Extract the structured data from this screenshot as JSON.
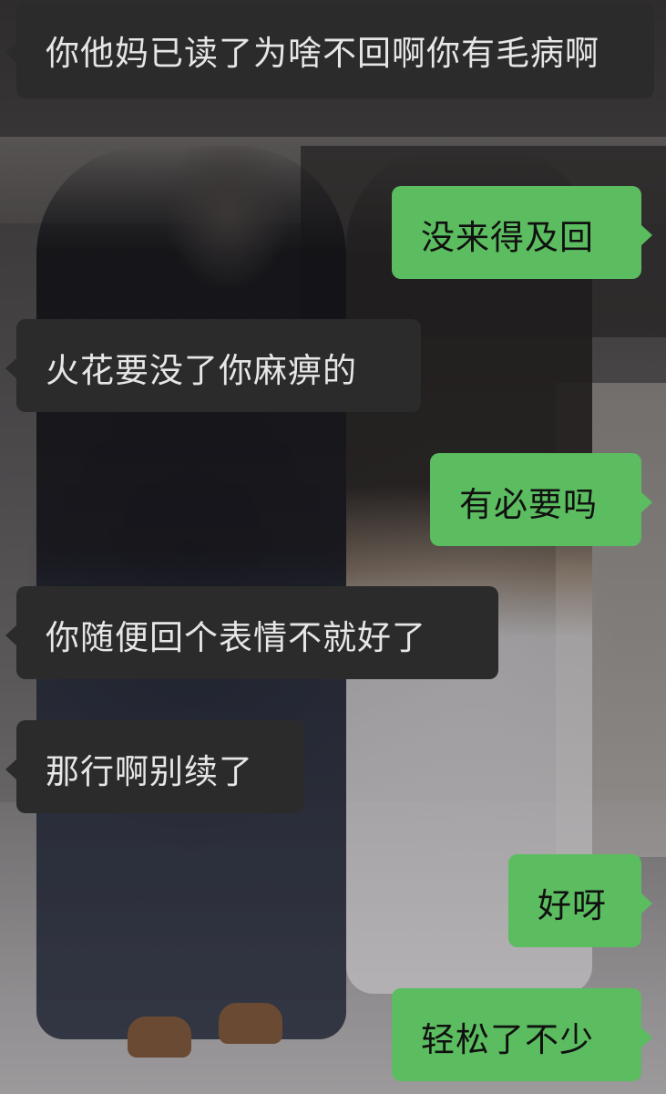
{
  "conversation": {
    "messages": [
      {
        "side": "received",
        "text": "你他妈已读了为啥不回啊你有毛病啊"
      },
      {
        "side": "sent",
        "text": "没来得及回"
      },
      {
        "side": "received",
        "text": "火花要没了你麻痹的"
      },
      {
        "side": "sent",
        "text": "有必要吗"
      },
      {
        "side": "received",
        "text": "你随便回个表情不就好了"
      },
      {
        "side": "received",
        "text": "那行啊别续了"
      },
      {
        "side": "sent",
        "text": "好呀"
      },
      {
        "side": "sent",
        "text": "轻松了不少"
      }
    ]
  },
  "colors": {
    "received_bubble": "#2b2b2b",
    "sent_bubble": "#5bbd5f",
    "received_text": "#e6e6e6",
    "sent_text": "#101010"
  }
}
